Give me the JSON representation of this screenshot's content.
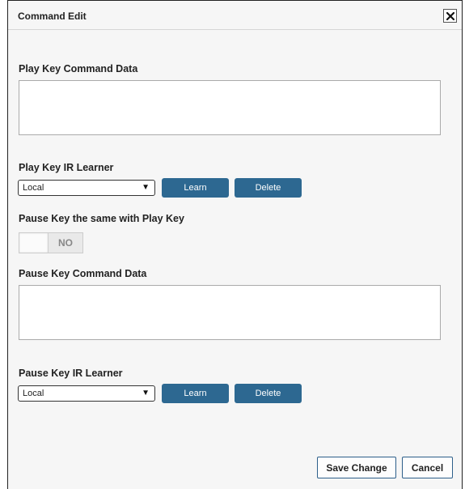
{
  "dialog": {
    "title": "Command Edit",
    "close_icon": "close-icon"
  },
  "play": {
    "command_label": "Play Key Command Data",
    "command_value": "",
    "learner_label": "Play Key IR Learner",
    "learner_selected": "Local",
    "learn_label": "Learn",
    "delete_label": "Delete"
  },
  "same_toggle": {
    "label": "Pause Key the same with Play Key",
    "state": "NO"
  },
  "pause": {
    "command_label": "Pause Key Command Data",
    "command_value": "",
    "learner_label": "Pause Key IR Learner",
    "learner_selected": "Local",
    "learn_label": "Learn",
    "delete_label": "Delete"
  },
  "footer": {
    "save_label": "Save Change",
    "cancel_label": "Cancel"
  },
  "colors": {
    "accent": "#2d6891",
    "background": "#f6f6f6"
  }
}
